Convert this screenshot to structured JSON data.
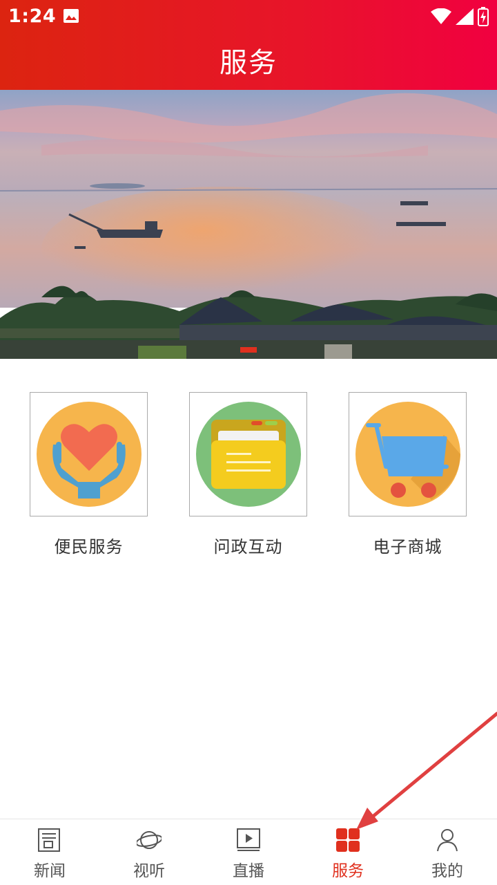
{
  "status_bar": {
    "time": "1:24",
    "icons": [
      "image-icon",
      "wifi-icon",
      "signal-icon",
      "battery-charging-icon"
    ]
  },
  "header": {
    "title": "服务"
  },
  "banner": {
    "active_index": 0,
    "slide_count": 1
  },
  "services": [
    {
      "label": "便民服务",
      "icon": "heart-hands-icon"
    },
    {
      "label": "问政互动",
      "icon": "folder-icon"
    },
    {
      "label": "电子商城",
      "icon": "shopping-cart-icon"
    }
  ],
  "tabbar": {
    "active": "服务",
    "active_color": "#e0301e",
    "items": [
      {
        "label": "新闻",
        "icon": "news-icon"
      },
      {
        "label": "视听",
        "icon": "planet-icon"
      },
      {
        "label": "直播",
        "icon": "play-icon"
      },
      {
        "label": "服务",
        "icon": "grid-icon"
      },
      {
        "label": "我的",
        "icon": "user-icon"
      }
    ]
  },
  "colors": {
    "header_start": "#dc2410",
    "header_end": "#f10040",
    "accent": "#e0301e"
  }
}
